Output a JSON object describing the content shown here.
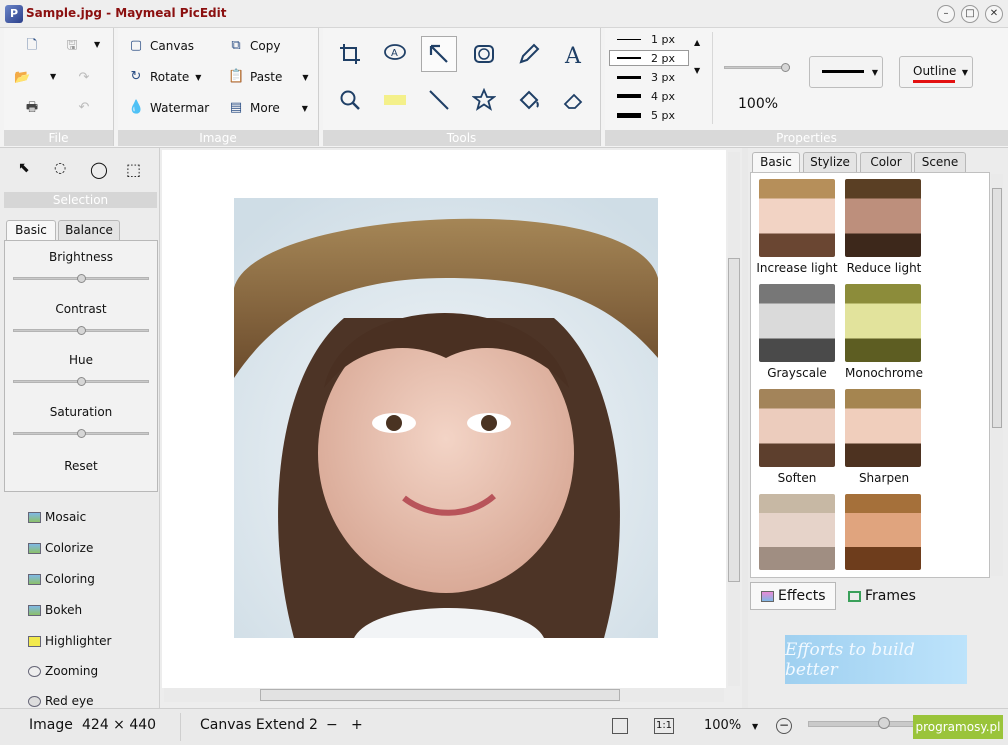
{
  "title": "Sample.jpg - Maymeal PicEdit",
  "ribbon": {
    "file_label": "File",
    "image_label": "Image",
    "tools_label": "Tools",
    "properties_label": "Properties",
    "canvas": "Canvas",
    "copy": "Copy",
    "rotate": "Rotate",
    "paste": "Paste",
    "watermar": "Watermar",
    "more": "More",
    "px_sizes": [
      "1 px",
      "2 px",
      "3 px",
      "4 px",
      "5 px"
    ],
    "zoom_slider_value": "100%",
    "outline": "Outline"
  },
  "selection_label": "Selection",
  "adjust": {
    "tab_basic": "Basic",
    "tab_balance": "Balance",
    "brightness": "Brightness",
    "contrast": "Contrast",
    "hue": "Hue",
    "saturation": "Saturation",
    "reset": "Reset"
  },
  "effects_list": [
    "Mosaic",
    "Colorize",
    "Coloring",
    "Bokeh",
    "Highlighter",
    "Zooming",
    "Red eye"
  ],
  "filter_tabs": [
    "Basic",
    "Stylize",
    "Color",
    "Scene"
  ],
  "filters": [
    "Increase light",
    "Reduce light",
    "Grayscale",
    "Monochrome",
    "Soften",
    "Sharpen"
  ],
  "bottom_tabs": {
    "effects": "Effects",
    "frames": "Frames"
  },
  "ad_text": "Efforts to build better",
  "status": {
    "image_label": "Image",
    "image_size": "424 × 440",
    "canvas_extend": "Canvas Extend",
    "canvas_value": "2",
    "zoom": "100%",
    "watermark": "programosy.pl"
  }
}
